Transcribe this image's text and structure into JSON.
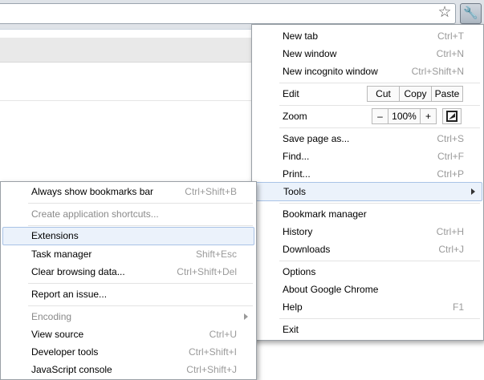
{
  "main_menu": {
    "new_tab": {
      "label": "New tab",
      "shortcut": "Ctrl+T"
    },
    "new_window": {
      "label": "New window",
      "shortcut": "Ctrl+N"
    },
    "new_incognito": {
      "label": "New incognito window",
      "shortcut": "Ctrl+Shift+N"
    },
    "edit": {
      "label": "Edit",
      "cut": "Cut",
      "copy": "Copy",
      "paste": "Paste"
    },
    "zoom": {
      "label": "Zoom",
      "minus": "–",
      "value": "100%",
      "plus": "+"
    },
    "save_page": {
      "label": "Save page as...",
      "shortcut": "Ctrl+S"
    },
    "find": {
      "label": "Find...",
      "shortcut": "Ctrl+F"
    },
    "print": {
      "label": "Print...",
      "shortcut": "Ctrl+P"
    },
    "tools": {
      "label": "Tools"
    },
    "bookmark_manager": {
      "label": "Bookmark manager"
    },
    "history": {
      "label": "History",
      "shortcut": "Ctrl+H"
    },
    "downloads": {
      "label": "Downloads",
      "shortcut": "Ctrl+J"
    },
    "options": {
      "label": "Options"
    },
    "about": {
      "label": "About Google Chrome"
    },
    "help": {
      "label": "Help",
      "shortcut": "F1"
    },
    "exit": {
      "label": "Exit"
    }
  },
  "tools_menu": {
    "bookmarks_bar": {
      "label": "Always show bookmarks bar",
      "shortcut": "Ctrl+Shift+B"
    },
    "app_shortcuts": {
      "label": "Create application shortcuts..."
    },
    "extensions": {
      "label": "Extensions"
    },
    "task_manager": {
      "label": "Task manager",
      "shortcut": "Shift+Esc"
    },
    "clear_data": {
      "label": "Clear browsing data...",
      "shortcut": "Ctrl+Shift+Del"
    },
    "report_issue": {
      "label": "Report an issue..."
    },
    "encoding": {
      "label": "Encoding"
    },
    "view_source": {
      "label": "View source",
      "shortcut": "Ctrl+U"
    },
    "dev_tools": {
      "label": "Developer tools",
      "shortcut": "Ctrl+Shift+I"
    },
    "js_console": {
      "label": "JavaScript console",
      "shortcut": "Ctrl+Shift+J"
    }
  },
  "icons": {
    "star": "star-icon",
    "wrench": "wrench-icon",
    "fullscreen": "fullscreen-icon"
  },
  "colors": {
    "highlight": "#ebf2fb",
    "highlight_border": "#a9c3e6"
  }
}
